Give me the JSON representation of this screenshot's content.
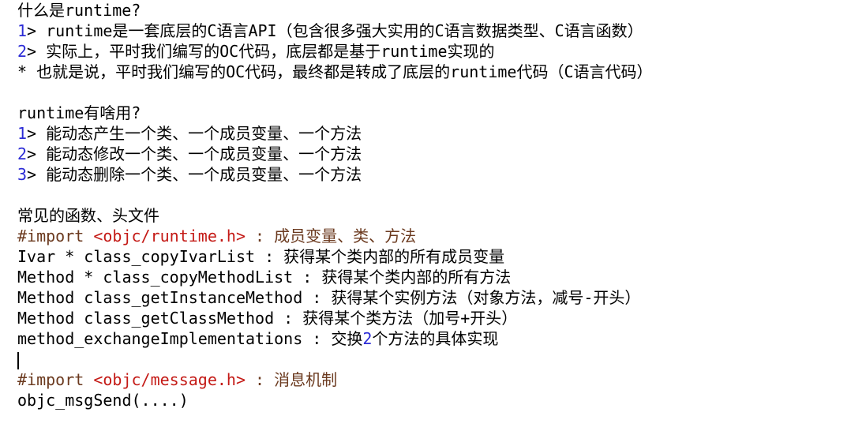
{
  "lines": {
    "l1": "什么是runtime?",
    "l2_num": "1",
    "l2_rest": "> runtime是一套底层的C语言API（包含很多强大实用的C语言数据类型、C语言函数）",
    "l3_num": "2",
    "l3_rest": "> 实际上，平时我们编写的OC代码，底层都是基于runtime实现的",
    "l4": "* 也就是说，平时我们编写的OC代码，最终都是转成了底层的runtime代码（C语言代码）",
    "l6": "runtime有啥用?",
    "l7_num": "1",
    "l7_rest": "> 能动态产生一个类、一个成员变量、一个方法",
    "l8_num": "2",
    "l8_rest": "> 能动态修改一个类、一个成员变量、一个方法",
    "l9_num": "3",
    "l9_rest": "> 能动态删除一个类、一个成员变量、一个方法",
    "l11": "常见的函数、头文件",
    "l12_directive": "#import",
    "l12_header": "<objc/runtime.h>",
    "l12_comment": " : 成员变量、类、方法",
    "l13": "Ivar * class_copyIvarList : 获得某个类内部的所有成员变量",
    "l14": "Method * class_copyMethodList : 获得某个类内部的所有方法",
    "l15": "Method class_getInstanceMethod : 获得某个实例方法（对象方法，减号-开头）",
    "l16": "Method class_getClassMethod : 获得某个类方法（加号+开头）",
    "l17_pre": "method_exchangeImplementations : 交换",
    "l17_num": "2",
    "l17_post": "个方法的具体实现",
    "l19_directive": "#import",
    "l19_header": "<objc/message.h>",
    "l19_comment": " : 消息机制",
    "l20": "objc_msgSend(....)"
  }
}
